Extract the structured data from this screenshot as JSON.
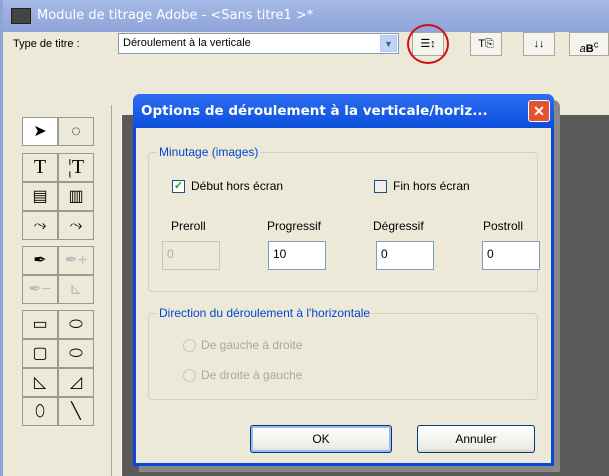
{
  "window": {
    "title": "Module de titrage Adobe - <Sans titre1 >*"
  },
  "toolbar": {
    "type_label": "Type de titre :",
    "type_value": "Déroulement à la verticale",
    "buttons": [
      "roll-crawl-options",
      "templates",
      "tab-stops",
      "styles"
    ]
  },
  "toolbox": {
    "tools": [
      "selection",
      "rotation",
      "type",
      "vertical-type",
      "area-type",
      "vertical-area-type",
      "path-type",
      "vertical-path-type",
      "pen",
      "add-anchor",
      "delete-anchor",
      "convert-anchor",
      "rectangle",
      "clipped-corner-rectangle",
      "rounded-corner-rectangle",
      "rounded-rectangle",
      "wedge",
      "arc",
      "ellipse",
      "line"
    ]
  },
  "dialog": {
    "title": "Options de déroulement à la verticale/horiz...",
    "timing": {
      "legend": "Minutage (images)",
      "start_offscreen": {
        "label": "Début hors écran",
        "checked": true
      },
      "end_offscreen": {
        "label": "Fin hors écran",
        "checked": false
      },
      "fields": [
        {
          "label": "Preroll",
          "value": "0",
          "enabled": false
        },
        {
          "label": "Progressif",
          "value": "10",
          "enabled": true
        },
        {
          "label": "Dégressif",
          "value": "0",
          "enabled": true
        },
        {
          "label": "Postroll",
          "value": "0",
          "enabled": true
        }
      ]
    },
    "direction": {
      "legend": "Direction du déroulement à l'horizontale",
      "options": [
        "De gauche à droite",
        "De droite à gauche"
      ]
    },
    "ok": "OK",
    "cancel": "Annuler"
  }
}
